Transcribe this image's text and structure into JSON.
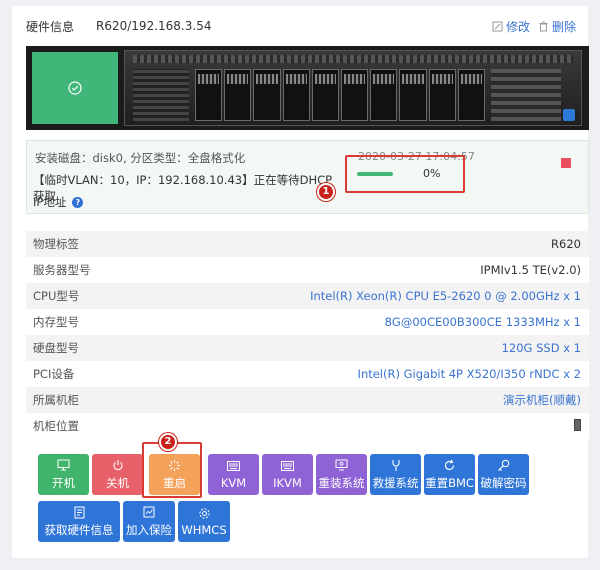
{
  "header": {
    "title": "硬件信息",
    "device": "R620/192.168.3.54",
    "edit_label": "修改",
    "delete_label": "删除"
  },
  "task": {
    "disk_line": "安装磁盘：disk0, 分区类型：全盘格式化",
    "status_line": "【临时VLAN：10，IP：192.168.10.43】正在等待DHCP获取",
    "status_line_cont": "IP地址",
    "timestamp": "2020-03-27 17:04:57",
    "progress_text": "0%",
    "progress_value": 0
  },
  "badges": {
    "one": "1",
    "two": "2"
  },
  "info": [
    {
      "label": "物理标签",
      "value": "R620"
    },
    {
      "label": "服务器型号",
      "value": "IPMIv1.5 TE(v2.0)"
    },
    {
      "label": "CPU型号",
      "value": "Intel(R) Xeon(R) CPU E5-2620 0 @ 2.00GHz x 1"
    },
    {
      "label": "内存型号",
      "value": "8G@00CE00B300CE 1333MHz x 1"
    },
    {
      "label": "硬盘型号",
      "value": "120G SSD x 1"
    },
    {
      "label": "PCI设备",
      "value": "Intel(R) Gigabit 4P X520/I350 rNDC x 2"
    },
    {
      "label": "所属机柜",
      "value": "演示机柜(顺戴)"
    },
    {
      "label": "机柜位置",
      "value": ""
    }
  ],
  "buttons": {
    "power_on": "开机",
    "power_off": "关机",
    "restart": "重启",
    "kvm": "KVM",
    "ikvm": "IKVM",
    "reinstall": "重装系统",
    "rescue": "救援系统",
    "reset_bmc": "重置BMC",
    "crack_password": "破解密码",
    "get_hardware": "获取硬件信息",
    "add_warranty": "加入保险",
    "whmcs": "WHMCS"
  },
  "colors": {
    "green": "#3fb46a",
    "red": "#e8616a",
    "orange": "#f4a25a",
    "purple": "#8f62d6",
    "blue": "#2f75d8",
    "highlight": "#d93b34"
  },
  "icons": {
    "status": "check-circle-icon",
    "edit": "edit-icon",
    "delete": "trash-icon",
    "help": "question-icon",
    "stop": "stop-icon",
    "rack": "rack-icon"
  }
}
